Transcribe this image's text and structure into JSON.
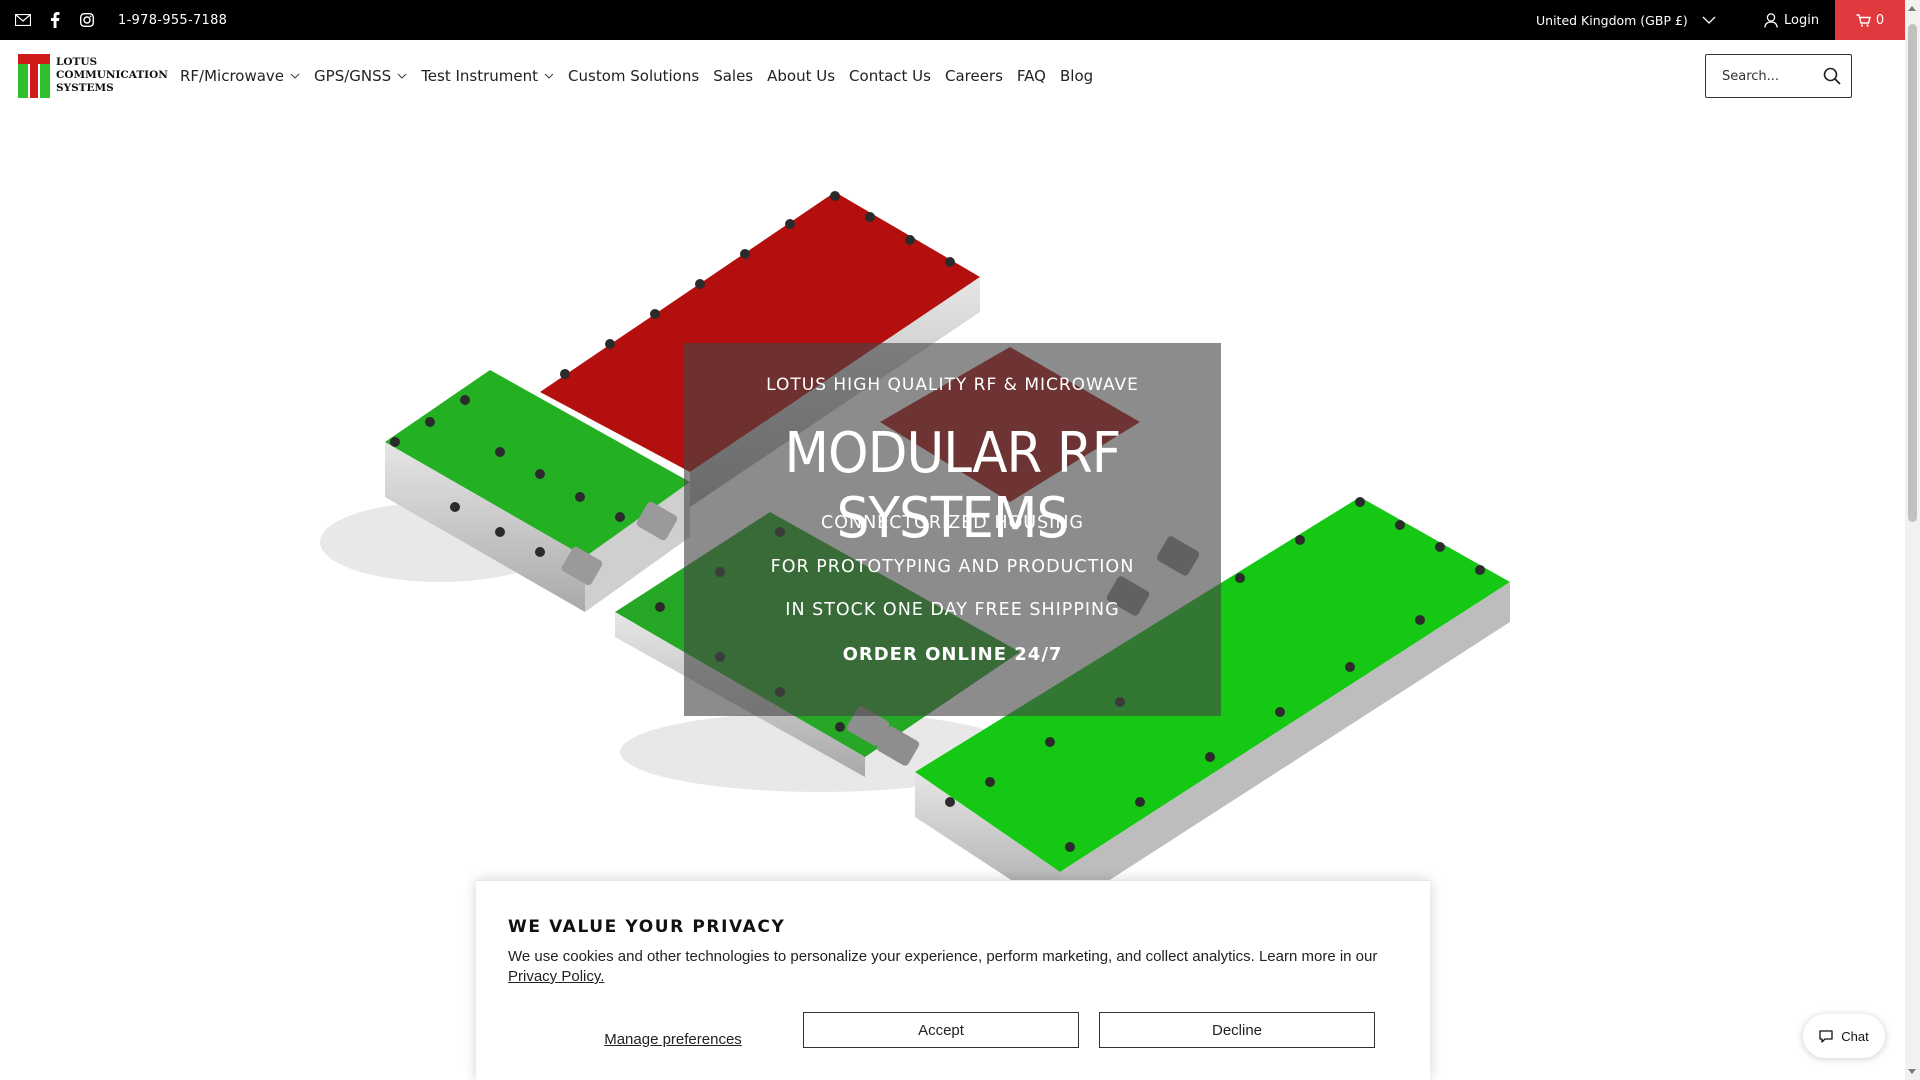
{
  "topbar": {
    "phone": "1-978-955-7188",
    "region": "United Kingdom (GBP £)",
    "login": "Login",
    "cart_count": "0",
    "icons": [
      "mail-icon",
      "facebook-icon",
      "instagram-icon",
      "user-icon",
      "cart-icon",
      "chevron-down-icon"
    ]
  },
  "logo": {
    "line1": "LOTUS",
    "line2": "COMMUNICATION",
    "line3": "SYSTEMS"
  },
  "nav": {
    "items": [
      "RF/Microwave",
      "GPS/GNSS",
      "Test Instrument",
      "Custom Solutions",
      "Sales",
      "About Us",
      "Contact Us",
      "Careers",
      "FAQ",
      "Blog"
    ]
  },
  "search": {
    "placeholder": "Search..."
  },
  "hero": {
    "pretitle": "LOTUS HIGH QUALITY RF & MICROWAVE",
    "title": "MODULAR RF SYSTEMS",
    "line1": "CONNECTORIZED HOUSING",
    "line2": "FOR PROTOTYPING AND PRODUCTION",
    "line3": "IN STOCK ONE DAY FREE SHIPPING",
    "cta": "ORDER ONLINE 24/7"
  },
  "privacy": {
    "heading": "WE VALUE YOUR PRIVACY",
    "body": "We use cookies and other technologies to personalize your experience, perform marketing, and collect analytics. Learn more in our",
    "link": "Privacy Policy.",
    "manage": "Manage preferences",
    "accept": "Accept",
    "decline": "Decline"
  },
  "chat": {
    "label": "Chat"
  },
  "colors": {
    "topbar": "#000000",
    "cart": "#e0393e",
    "module_red": "#b40f0f",
    "module_green": "#1eb01e"
  }
}
